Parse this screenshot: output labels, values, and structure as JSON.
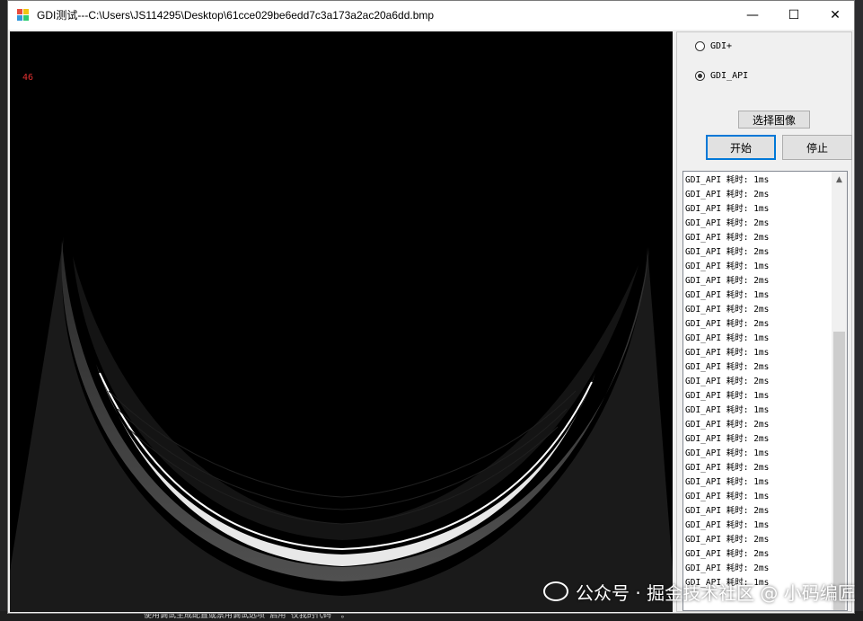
{
  "window": {
    "title": "GDI测试---C:\\Users\\JS114295\\Desktop\\61cce029be6edd7c3a173a2ac20a6dd.bmp",
    "minimize": "—",
    "maximize": "☐",
    "close": "✕"
  },
  "canvas": {
    "fps_label": "46"
  },
  "panel": {
    "radio_gdiplus": "GDI+",
    "radio_gdiapi": "GDI_API",
    "selected": "GDI_API",
    "select_image_button": "选择图像",
    "start_button": "开始",
    "stop_button": "停止",
    "log_lines": [
      "GDI_API 耗时: 1ms",
      "GDI_API 耗时: 2ms",
      "GDI_API 耗时: 1ms",
      "GDI_API 耗时: 2ms",
      "GDI_API 耗时: 2ms",
      "GDI_API 耗时: 2ms",
      "GDI_API 耗时: 1ms",
      "GDI_API 耗时: 2ms",
      "GDI_API 耗时: 1ms",
      "GDI_API 耗时: 2ms",
      "GDI_API 耗时: 2ms",
      "GDI_API 耗时: 1ms",
      "GDI_API 耗时: 1ms",
      "GDI_API 耗时: 2ms",
      "GDI_API 耗时: 2ms",
      "GDI_API 耗时: 1ms",
      "GDI_API 耗时: 1ms",
      "GDI_API 耗时: 2ms",
      "GDI_API 耗时: 2ms",
      "GDI_API 耗时: 1ms",
      "GDI_API 耗时: 2ms",
      "GDI_API 耗时: 1ms",
      "GDI_API 耗时: 1ms",
      "GDI_API 耗时: 2ms",
      "GDI_API 耗时: 1ms",
      "GDI_API 耗时: 2ms",
      "GDI_API 耗时: 2ms",
      "GDI_API 耗时: 2ms",
      "GDI_API 耗时: 1ms"
    ]
  },
  "watermark": {
    "text": "公众号 · 掘金技术社区 @ 小码编匠"
  },
  "background": {
    "bottom_text": "使用调试生成配置或禁用调试选项“启用‘仅我的代码’”。"
  },
  "colors": {
    "canvas_bg": "#000000",
    "fps_color": "#e03030",
    "accent_border": "#0078d7"
  }
}
